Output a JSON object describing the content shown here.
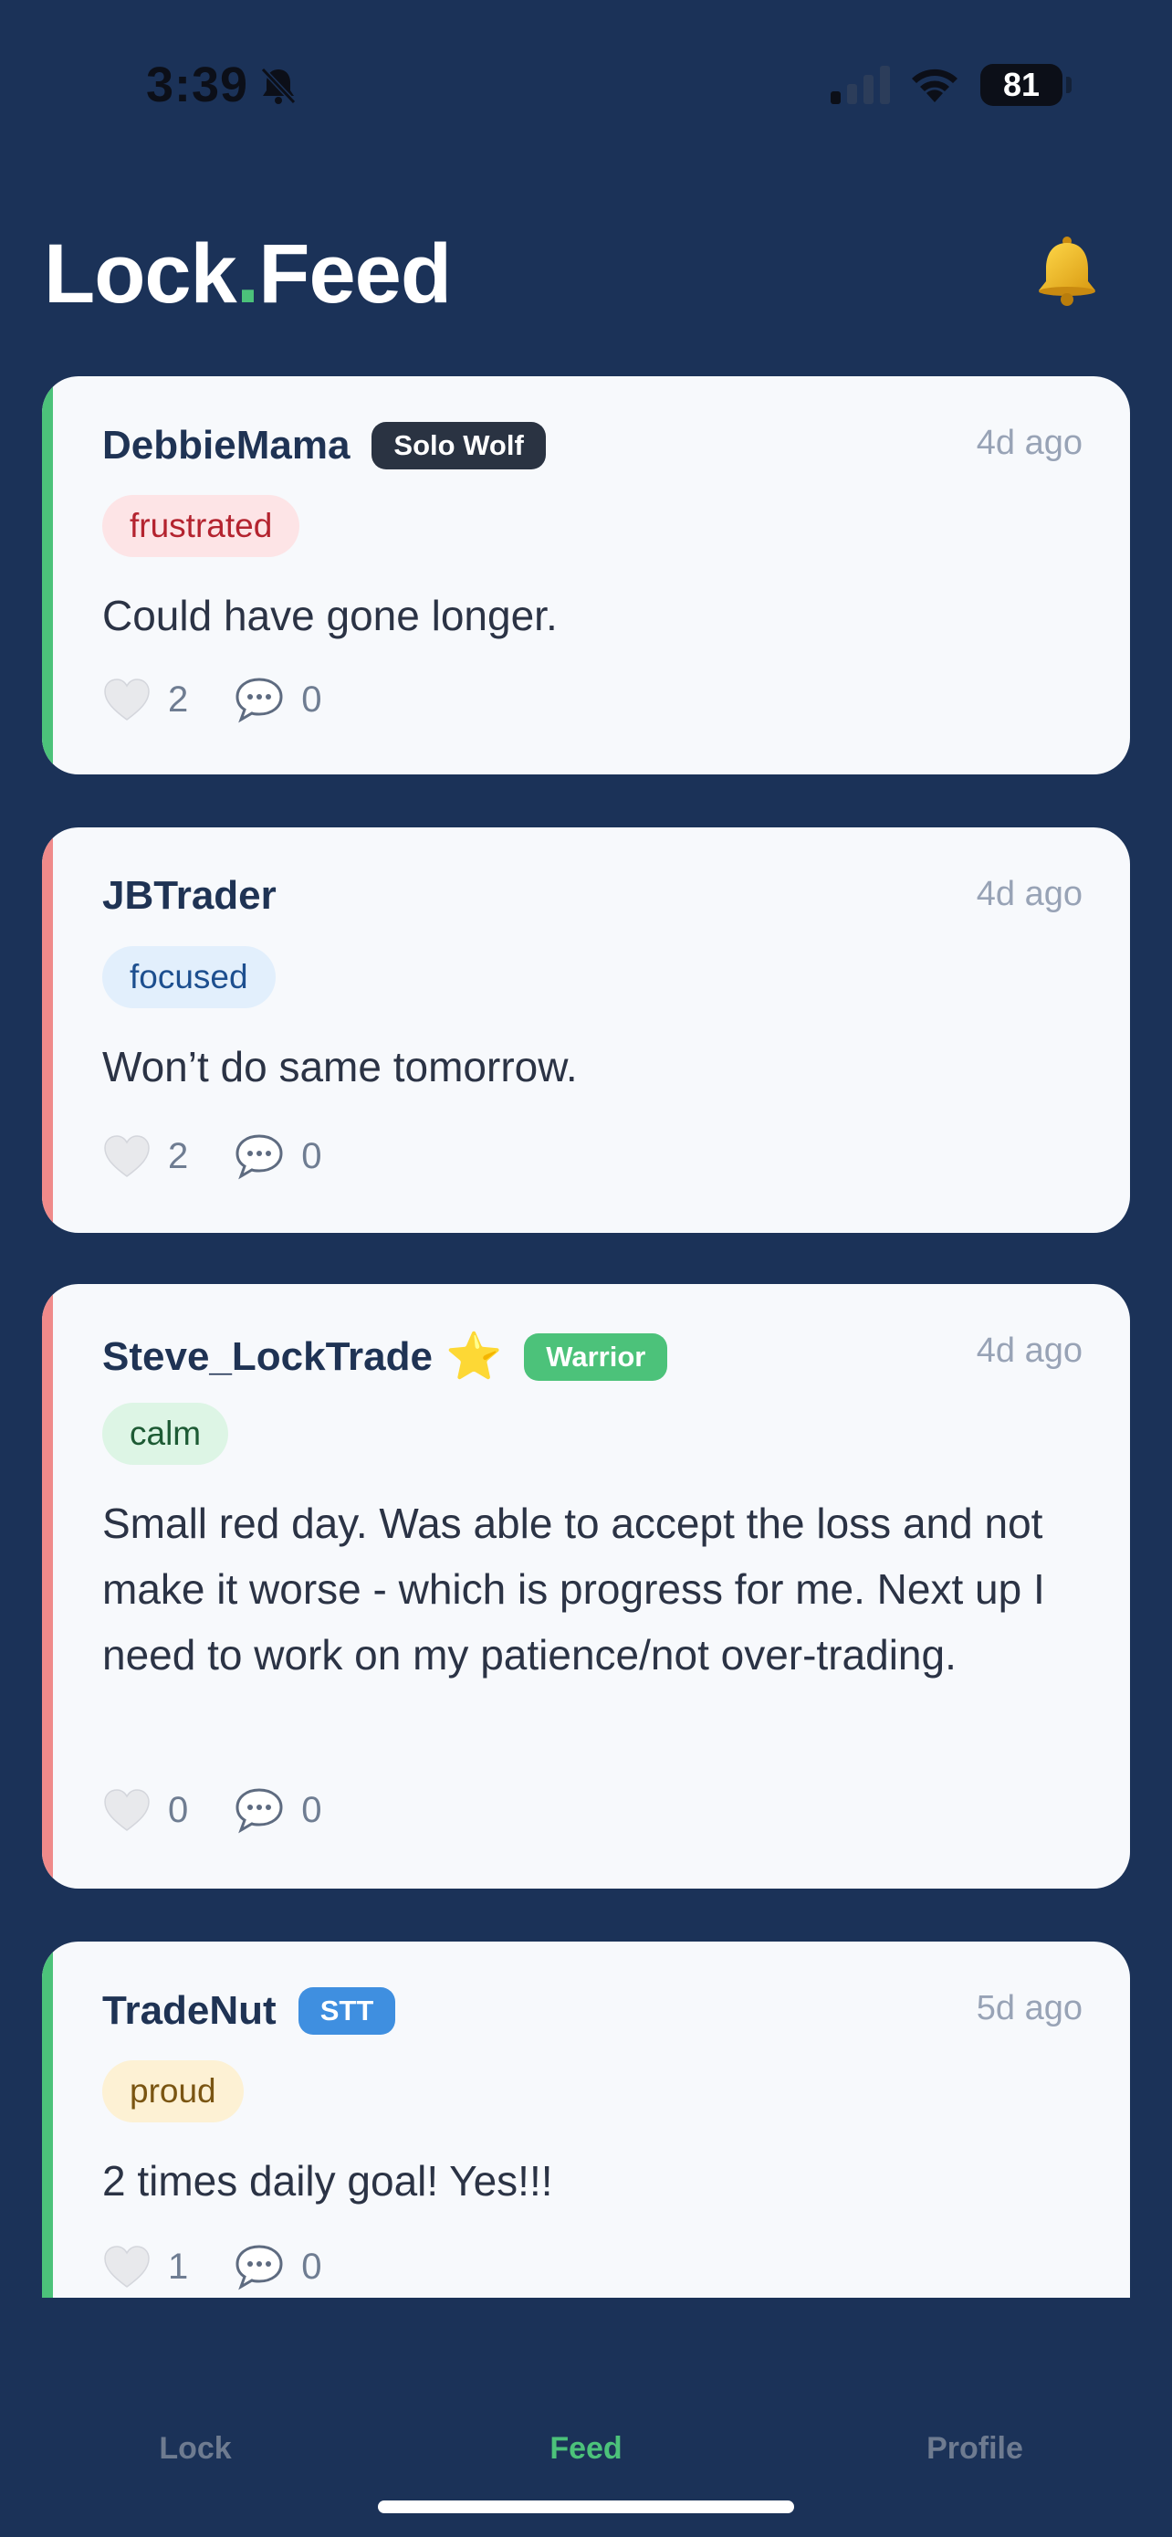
{
  "status_bar": {
    "time": "3:39",
    "battery": "81"
  },
  "header": {
    "title_left": "Lock",
    "title_dot": ".",
    "title_right": "Feed"
  },
  "posts": [
    {
      "user": "DebbieMama",
      "badge": "Solo Wolf",
      "badge_color": "#2a3342",
      "time": "4d ago",
      "mood": "frustrated",
      "mood_bg": "#fde4e6",
      "mood_fg": "#b4232f",
      "accent": "#4cc27a",
      "text": "Could have gone longer.",
      "likes": "2",
      "comments": "0"
    },
    {
      "user": "JBTrader",
      "badge": "",
      "time": "4d ago",
      "mood": "focused",
      "mood_bg": "#e2effc",
      "mood_fg": "#1d4f8f",
      "accent": "#f08a8a",
      "text": "Won’t do same tomorrow.",
      "likes": "2",
      "comments": "0"
    },
    {
      "user": "Steve_LockTrade",
      "star": "⭐",
      "badge": "Warrior",
      "badge_color": "#4cc27a",
      "time": "4d ago",
      "mood": "calm",
      "mood_bg": "#ddf5e5",
      "mood_fg": "#1d5a34",
      "accent": "#f08a8a",
      "text": "Small red day. Was able to accept the loss and not make it worse - which is progress for me. Next up I need to work on my patience/not over-trading.",
      "likes": "0",
      "comments": "0"
    },
    {
      "user": "TradeNut",
      "badge": "STT",
      "badge_color": "#3f8fe0",
      "time": "5d ago",
      "mood": "proud",
      "mood_bg": "#fdf1d4",
      "mood_fg": "#7a5512",
      "accent": "#4cc27a",
      "text": "2 times daily goal! Yes!!!",
      "likes": "1",
      "comments": "0"
    }
  ],
  "tabs": [
    {
      "label": "Lock",
      "active": false
    },
    {
      "label": "Feed",
      "active": true
    },
    {
      "label": "Profile",
      "active": false
    }
  ]
}
